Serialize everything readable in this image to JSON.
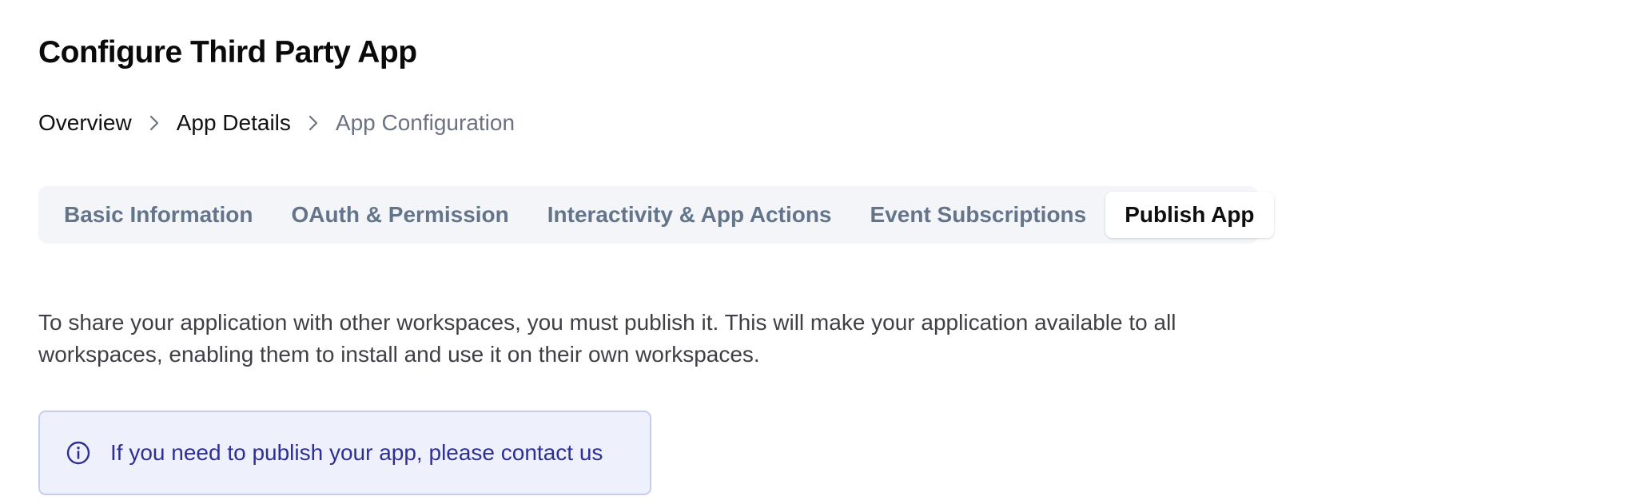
{
  "page": {
    "title": "Configure Third Party App"
  },
  "breadcrumb": {
    "items": [
      {
        "label": "Overview"
      },
      {
        "label": "App Details"
      },
      {
        "label": "App Configuration"
      }
    ],
    "separator_icon": "chevron-right-icon"
  },
  "tabs": {
    "items": [
      {
        "label": "Basic Information",
        "active": false
      },
      {
        "label": "OAuth & Permission",
        "active": false
      },
      {
        "label": "Interactivity & App Actions",
        "active": false
      },
      {
        "label": "Event Subscriptions",
        "active": false
      },
      {
        "label": "Publish App",
        "active": true
      }
    ]
  },
  "content": {
    "description": "To share your application with other workspaces, you must publish it. This will make your application available to all workspaces, enabling them to install and use it on their own workspaces."
  },
  "notice": {
    "icon": "info-icon",
    "text": "If you need to publish your app, please contact us"
  },
  "colors": {
    "tab_bar_background": "#f3f5f9",
    "tab_inactive_text": "#64748b",
    "notice_background": "#eef0fb",
    "notice_border": "#c7cdf0",
    "notice_text": "#2e2f96"
  }
}
